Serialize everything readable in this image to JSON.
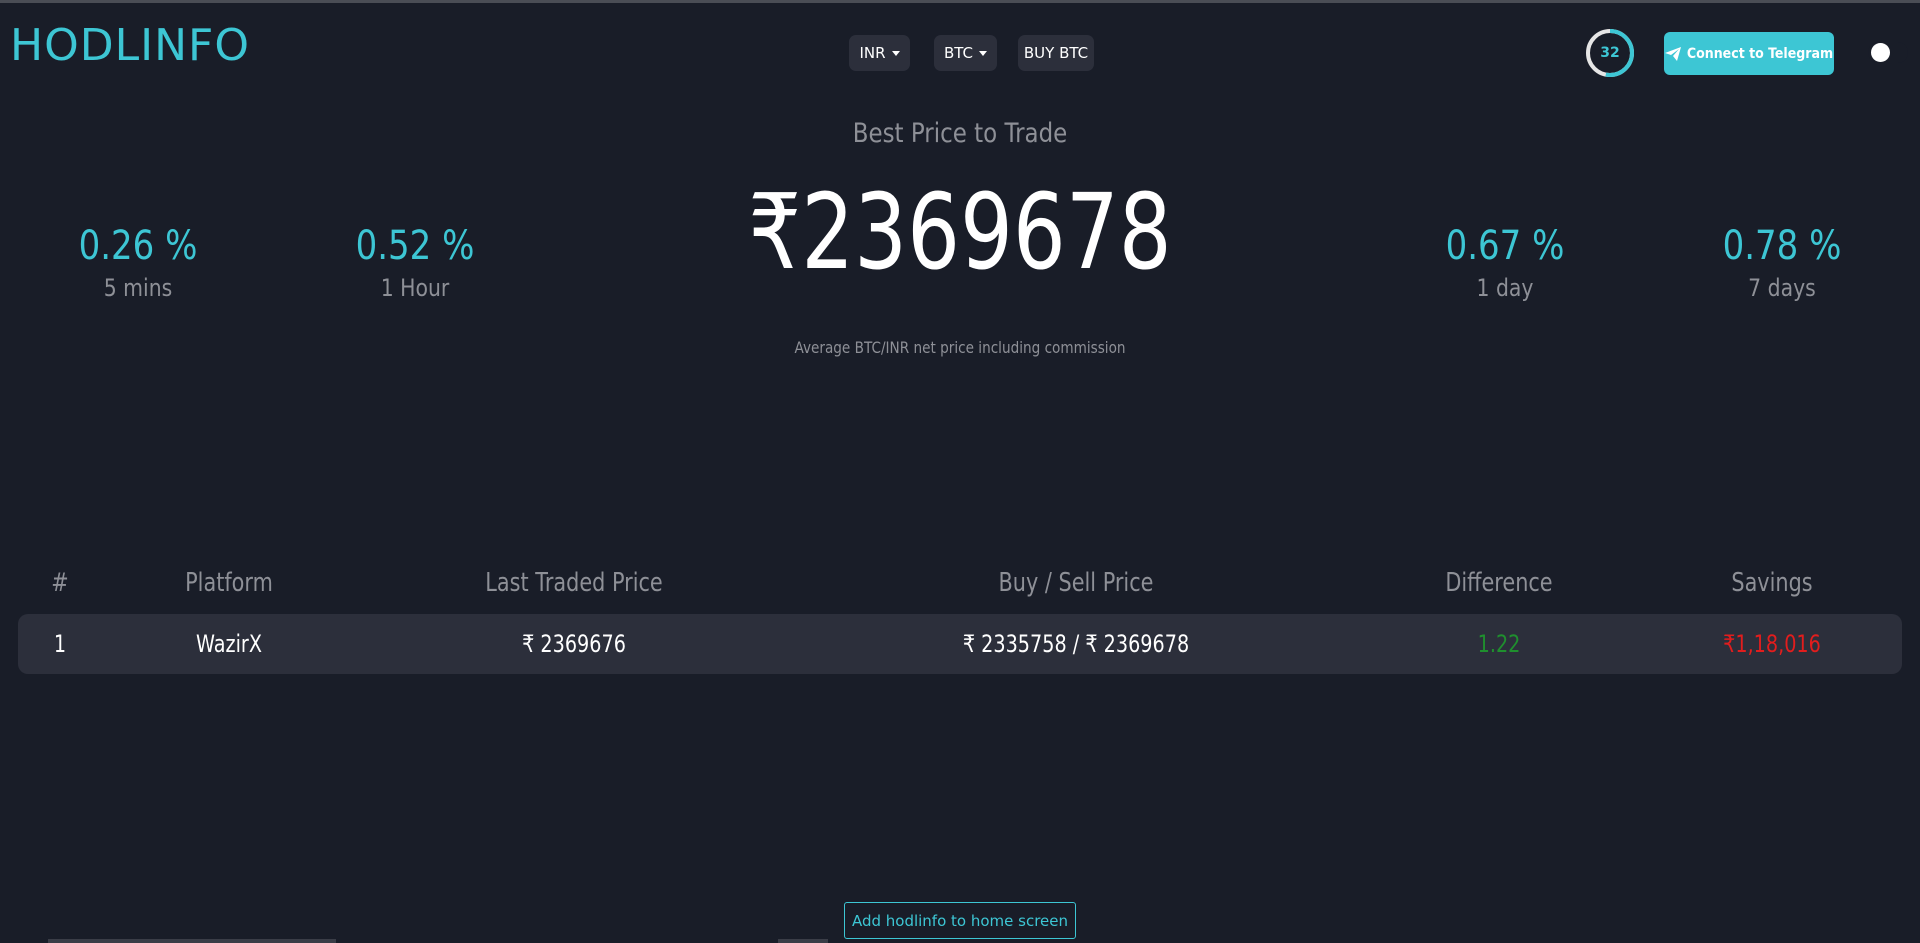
{
  "header": {
    "logo": "HODLINFO",
    "currency_select": "INR",
    "coin_select": "BTC",
    "buy_label": "BUY BTC",
    "timer_value": "32",
    "timer_progress_fraction": 0.53,
    "telegram_label": "Connect to Telegram",
    "theme_toggle_on": false
  },
  "hero": {
    "title": "Best Price to Trade",
    "price": "₹2369678",
    "note": "Average BTC/INR net price including commission",
    "stats": [
      {
        "value": "0.26 %",
        "label": "5 mins"
      },
      {
        "value": "0.52 %",
        "label": "1 Hour"
      },
      {
        "value": "0.67 %",
        "label": "1 day"
      },
      {
        "value": "0.78 %",
        "label": "7 days"
      }
    ]
  },
  "table": {
    "headers": [
      "#",
      "Platform",
      "Last Traded Price",
      "Buy / Sell Price",
      "Difference",
      "Savings"
    ],
    "rows": [
      {
        "rank": "1",
        "platform": "WazirX",
        "last_price": "₹ 2369676",
        "buy_sell": "₹ 2335758 / ₹ 2369678",
        "difference": "1.22",
        "savings": "₹1,18,016"
      }
    ]
  },
  "footer": {
    "add_label": "Add hodlinfo to home screen"
  },
  "colors": {
    "background": "#191d28",
    "accent": "#3dc6d4",
    "muted": "#8e9097",
    "row_bg": "#2c2f3b",
    "positive": "#1f8f2e",
    "negative": "#e21d1d"
  },
  "icons": {
    "telegram": "paper-plane-icon",
    "dropdown": "caret-down-icon"
  }
}
